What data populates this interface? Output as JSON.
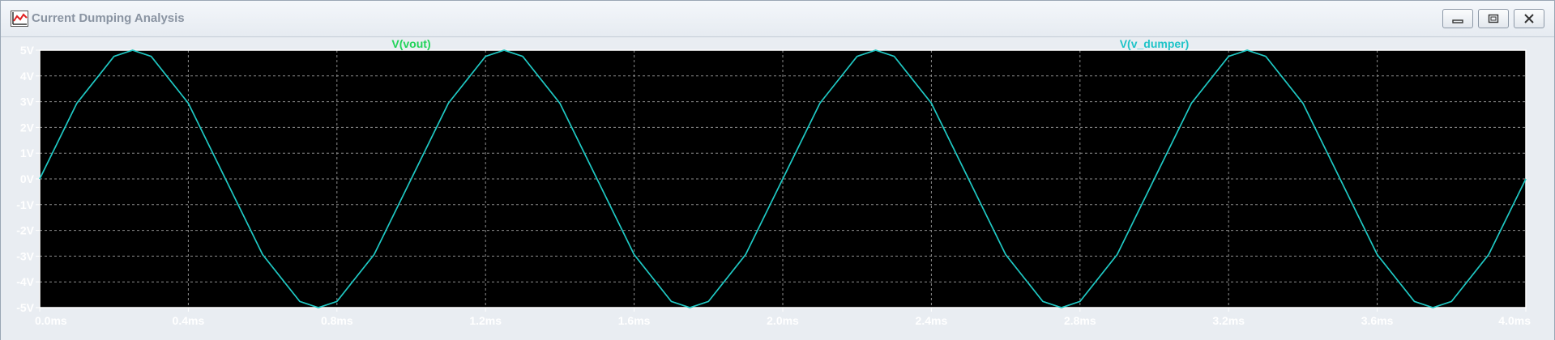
{
  "window": {
    "title": "Current Dumping Analysis",
    "icons": {
      "app": "waveform-app-icon",
      "minimize": "minimize-icon",
      "maximize": "restore-icon",
      "close": "close-icon"
    }
  },
  "colors": {
    "plot_background": "#000000",
    "grid": "#8c8c8c",
    "axis_text": "#ffffff",
    "trace_vout": "#22d45a",
    "trace_v_dumper": "#1fc4c8"
  },
  "chart_data": {
    "type": "line",
    "title": "",
    "xlabel": "",
    "ylabel": "",
    "xlim": [
      0.0,
      4.0
    ],
    "ylim": [
      -5,
      5
    ],
    "x_unit": "ms",
    "y_unit": "V",
    "x_ticks": [
      "0.0ms",
      "0.4ms",
      "0.8ms",
      "1.2ms",
      "1.6ms",
      "2.0ms",
      "2.4ms",
      "2.8ms",
      "3.2ms",
      "3.6ms",
      "4.0ms"
    ],
    "y_ticks": [
      "5V",
      "4V",
      "3V",
      "2V",
      "1V",
      "0V",
      "-1V",
      "-2V",
      "-3V",
      "-4V",
      "-5V"
    ],
    "grid": true,
    "legend": "top",
    "series": [
      {
        "name": "V(vout)",
        "x": [
          0.0,
          0.1,
          0.2,
          0.25,
          0.3,
          0.4,
          0.5,
          0.6,
          0.7,
          0.75,
          0.8,
          0.9,
          1.0,
          1.1,
          1.2,
          1.25,
          1.3,
          1.4,
          1.5,
          1.6,
          1.7,
          1.75,
          1.8,
          1.9,
          2.0,
          2.1,
          2.2,
          2.25,
          2.3,
          2.4,
          2.5,
          2.6,
          2.7,
          2.75,
          2.8,
          2.9,
          3.0,
          3.1,
          3.2,
          3.25,
          3.3,
          3.4,
          3.5,
          3.6,
          3.7,
          3.75,
          3.8,
          3.9,
          4.0
        ],
        "values": [
          0.0,
          2.94,
          4.76,
          5.0,
          4.76,
          2.94,
          0.0,
          -2.94,
          -4.76,
          -5.0,
          -4.76,
          -2.94,
          0.0,
          2.94,
          4.76,
          5.0,
          4.76,
          2.94,
          0.0,
          -2.94,
          -4.76,
          -5.0,
          -4.76,
          -2.94,
          0.0,
          2.94,
          4.76,
          5.0,
          4.76,
          2.94,
          0.0,
          -2.94,
          -4.76,
          -5.0,
          -4.76,
          -2.94,
          0.0,
          2.94,
          4.76,
          5.0,
          4.76,
          2.94,
          0.0,
          -2.94,
          -4.76,
          -5.0,
          -4.76,
          -2.94,
          0.0
        ]
      },
      {
        "name": "V(v_dumper)",
        "x": [
          0.0,
          0.1,
          0.2,
          0.25,
          0.3,
          0.4,
          0.5,
          0.6,
          0.7,
          0.75,
          0.8,
          0.9,
          1.0,
          1.1,
          1.2,
          1.25,
          1.3,
          1.4,
          1.5,
          1.6,
          1.7,
          1.75,
          1.8,
          1.9,
          2.0,
          2.1,
          2.2,
          2.25,
          2.3,
          2.4,
          2.5,
          2.6,
          2.7,
          2.75,
          2.8,
          2.9,
          3.0,
          3.1,
          3.2,
          3.25,
          3.3,
          3.4,
          3.5,
          3.6,
          3.7,
          3.75,
          3.8,
          3.9,
          4.0
        ],
        "values": [
          0.0,
          2.94,
          4.76,
          5.0,
          4.76,
          2.94,
          0.0,
          -2.94,
          -4.76,
          -5.0,
          -4.76,
          -2.94,
          0.0,
          2.94,
          4.76,
          5.0,
          4.76,
          2.94,
          0.0,
          -2.94,
          -4.76,
          -5.0,
          -4.76,
          -2.94,
          0.0,
          2.94,
          4.76,
          5.0,
          4.76,
          2.94,
          0.0,
          -2.94,
          -4.76,
          -5.0,
          -4.76,
          -2.94,
          0.0,
          2.94,
          4.76,
          5.0,
          4.76,
          2.94,
          0.0,
          -2.94,
          -4.76,
          -5.0,
          -4.76,
          -2.94,
          0.0
        ]
      }
    ]
  }
}
